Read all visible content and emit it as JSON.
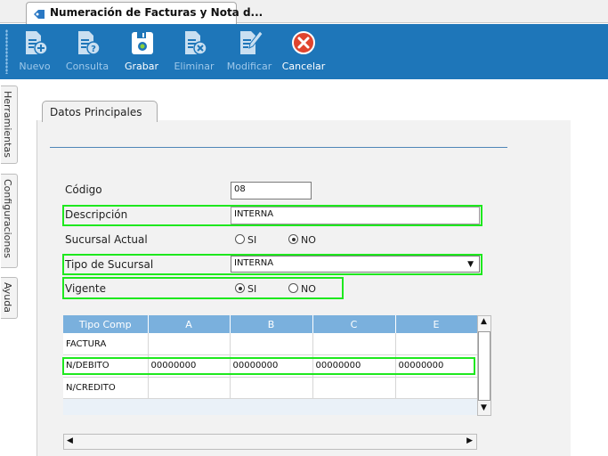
{
  "window": {
    "tab_title": "Numeración de Facturas y Nota d..."
  },
  "toolbar": {
    "nuevo": "Nuevo",
    "consulta": "Consulta",
    "grabar": "Grabar",
    "eliminar": "Eliminar",
    "modificar": "Modificar",
    "cancelar": "Cancelar"
  },
  "side_tabs": [
    "Herramientas",
    "Configuraciones",
    "Ayuda"
  ],
  "main_tab": "Datos Principales",
  "form": {
    "codigo_label": "Código",
    "codigo_value": "08",
    "descripcion_label": "Descripción",
    "descripcion_value": "INTERNA",
    "sucursal_actual_label": "Sucursal Actual",
    "sucursal_actual_si": "SI",
    "sucursal_actual_no": "NO",
    "sucursal_actual_selected": "NO",
    "tipo_sucursal_label": "Tipo de Sucursal",
    "tipo_sucursal_value": "INTERNA",
    "vigente_label": "Vigente",
    "vigente_si": "SI",
    "vigente_no": "NO",
    "vigente_selected": "SI"
  },
  "grid": {
    "headers": [
      "Tipo Comp",
      "A",
      "B",
      "C",
      "E"
    ],
    "rows": [
      [
        "FACTURA",
        "",
        "",
        "",
        ""
      ],
      [
        "N/DEBITO",
        "00000000",
        "00000000",
        "00000000",
        "00000000"
      ],
      [
        "N/CREDITO",
        "",
        "",
        "",
        ""
      ]
    ]
  },
  "colors": {
    "toolbar": "#1e76b9",
    "grid_header": "#7ab0dd",
    "highlight": "#1ee81e",
    "cancel": "#e0442e"
  }
}
